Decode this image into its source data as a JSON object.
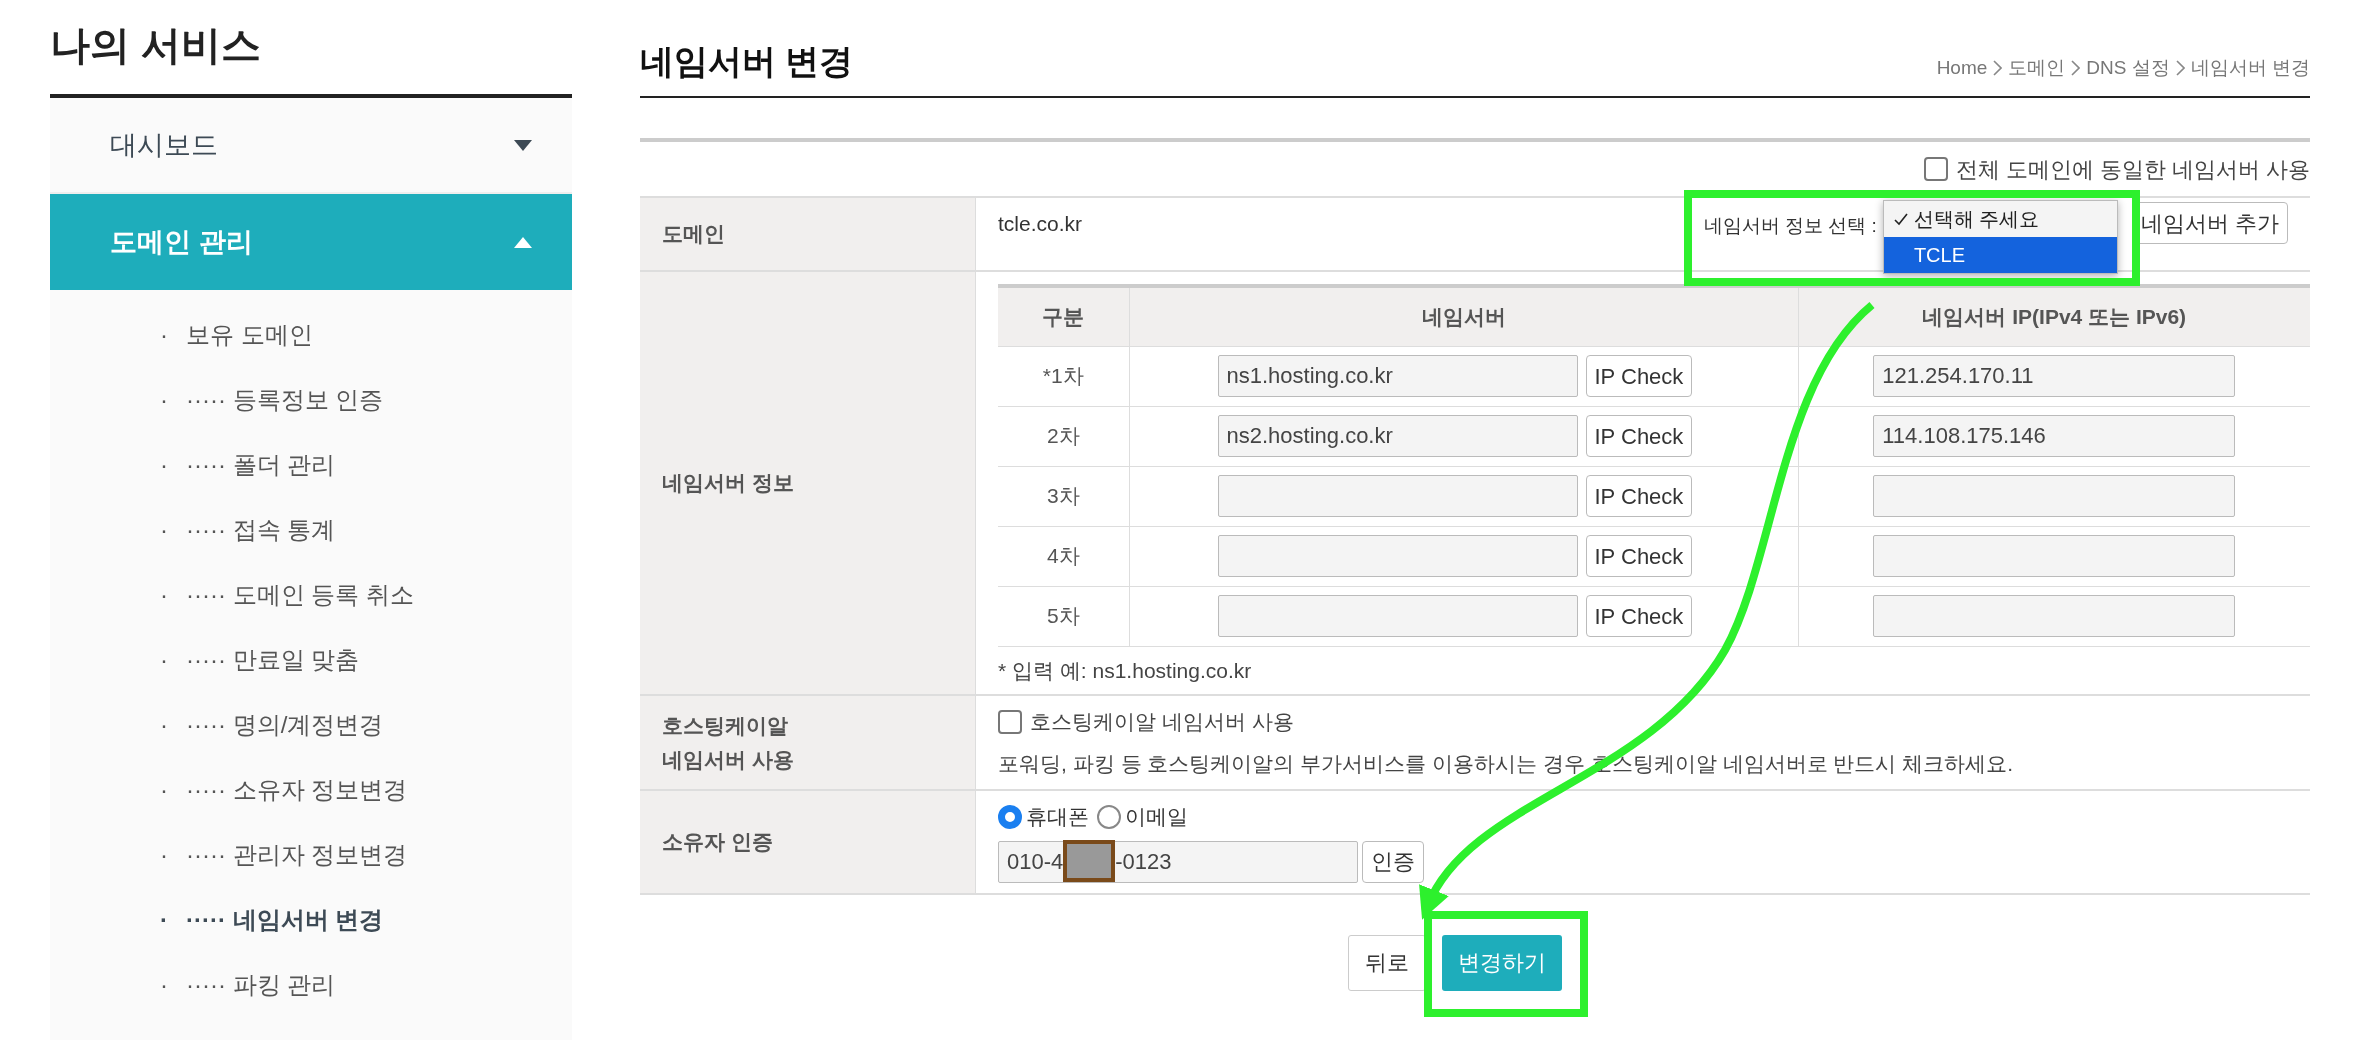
{
  "sidebar": {
    "title": "나의 서비스",
    "bullet": "·",
    "menus": [
      {
        "label": "대시보드",
        "expanded": false
      },
      {
        "label": "도메인 관리",
        "expanded": true,
        "children": [
          {
            "label": "보유 도메인",
            "selected": false
          },
          {
            "label": "····· 등록정보 인증",
            "selected": false
          },
          {
            "label": "····· 폴더 관리",
            "selected": false
          },
          {
            "label": "····· 접속 통계",
            "selected": false
          },
          {
            "label": "····· 도메인 등록 취소",
            "selected": false
          },
          {
            "label": "····· 만료일 맞춤",
            "selected": false
          },
          {
            "label": "····· 명의/계정변경",
            "selected": false
          },
          {
            "label": "····· 소유자 정보변경",
            "selected": false
          },
          {
            "label": "····· 관리자 정보변경",
            "selected": false
          },
          {
            "label": "····· 네임서버 변경",
            "selected": true
          },
          {
            "label": "····· 파킹 관리",
            "selected": false
          }
        ]
      }
    ]
  },
  "page": {
    "title": "네임서버 변경",
    "breadcrumb": [
      "Home",
      "도메인",
      "DNS 설정",
      "네임서버 변경"
    ]
  },
  "form": {
    "same_ns": {
      "label": "전체 도메인에 동일한 네임서버 사용",
      "checked": false
    },
    "domain": {
      "label": "도메인",
      "value": "tcle.co.kr"
    },
    "ns_select": {
      "label": "네임서버 정보 선택 :",
      "options": [
        {
          "label": "선택해 주세요",
          "checked": true,
          "selected": false
        },
        {
          "label": "TCLE",
          "checked": false,
          "selected": true
        }
      ]
    },
    "add_button": "네임서버 추가",
    "ns_info": {
      "label": "네임서버 정보",
      "columns": [
        "구분",
        "네임서버",
        "네임서버 IP(IPv4 또는 IPv6)"
      ],
      "rows": [
        {
          "order": "*1차",
          "nameserver": "ns1.hosting.co.kr",
          "check_button": "IP Check",
          "ip": "121.254.170.11"
        },
        {
          "order": "2차",
          "nameserver": "ns2.hosting.co.kr",
          "check_button": "IP Check",
          "ip": "114.108.175.146"
        },
        {
          "order": "3차",
          "check_button": "IP Check"
        },
        {
          "order": "4차",
          "check_button": "IP Check"
        },
        {
          "order": "5차",
          "check_button": "IP Check"
        }
      ],
      "note": "* 입력 예: ns1.hosting.co.kr"
    },
    "hosting": {
      "label_lines": [
        "호스팅케이알",
        "네임서버 사용"
      ],
      "checkbox": {
        "label": "호스팅케이알 네임서버 사용",
        "checked": false
      },
      "description": "포워딩, 파킹 등 호스팅케이알의 부가서비스를 이용하시는 경우 호스팅케이알 네임서버로 반드시 체크하세요."
    },
    "owner_auth": {
      "label": "소유자 인증",
      "methods": [
        {
          "label": "휴대폰",
          "selected": true
        },
        {
          "label": "이메일",
          "selected": false
        }
      ],
      "phone": {
        "prefix": "010-4",
        "suffix": "-0123",
        "redacted": true
      },
      "verify_button": "인증"
    }
  },
  "buttons": [
    {
      "label": "뒤로",
      "kind": "secondary"
    },
    {
      "label": "변경하기",
      "kind": "primary"
    }
  ]
}
